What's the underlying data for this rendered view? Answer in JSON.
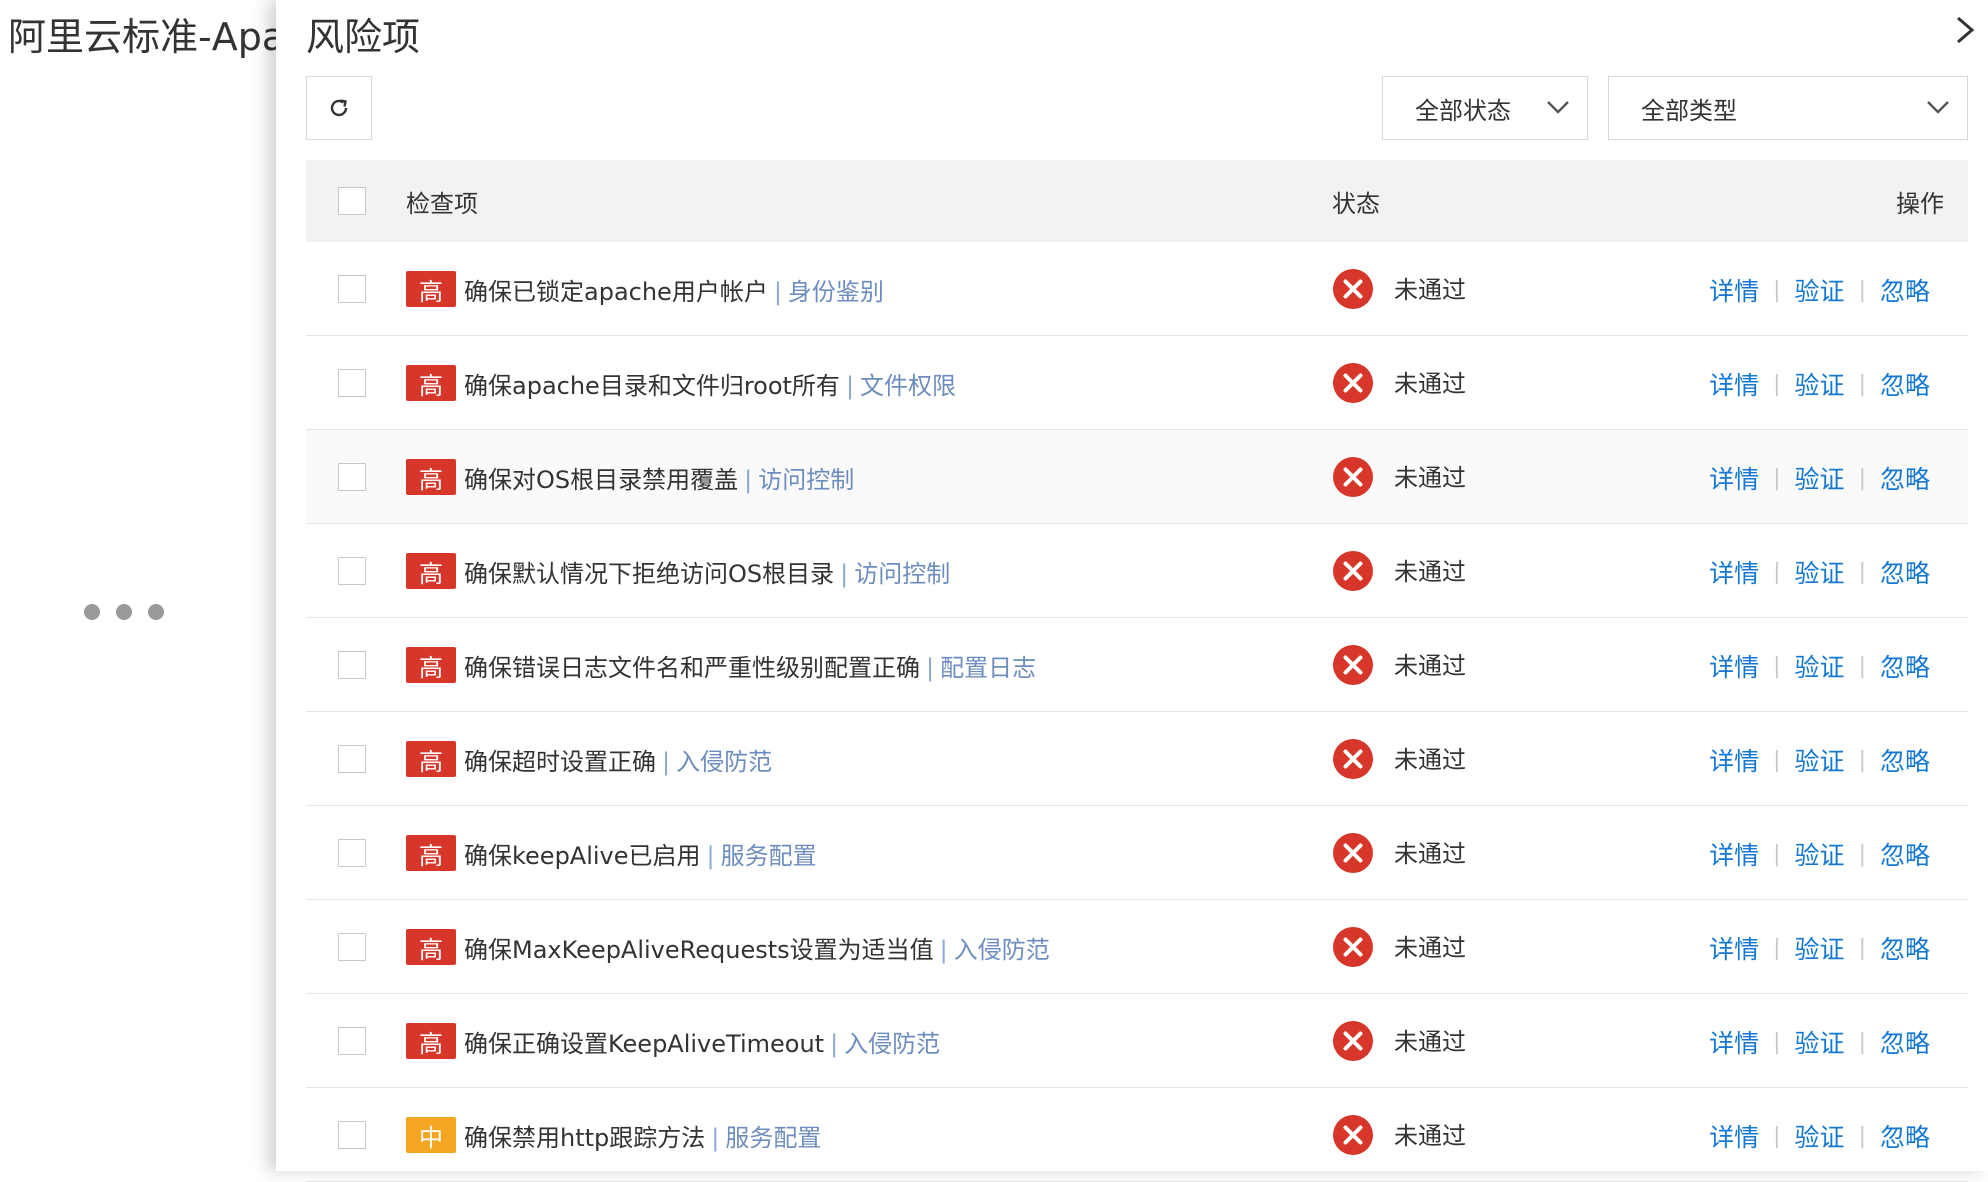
{
  "background": {
    "title": "阿里云标准-Apac"
  },
  "drawer": {
    "title": "风险项",
    "filters": {
      "status": "全部状态",
      "type": "全部类型"
    }
  },
  "table": {
    "headers": {
      "item": "检查项",
      "status": "状态",
      "ops": "操作"
    },
    "rows": [
      {
        "level": "高",
        "level_type": "high",
        "text": "确保已锁定apache用户帐户",
        "category": "身份鉴别",
        "status": "未通过"
      },
      {
        "level": "高",
        "level_type": "high",
        "text": "确保apache目录和文件归root所有",
        "category": "文件权限",
        "status": "未通过"
      },
      {
        "level": "高",
        "level_type": "high",
        "text": "确保对OS根目录禁用覆盖",
        "category": "访问控制",
        "status": "未通过"
      },
      {
        "level": "高",
        "level_type": "high",
        "text": "确保默认情况下拒绝访问OS根目录",
        "category": "访问控制",
        "status": "未通过"
      },
      {
        "level": "高",
        "level_type": "high",
        "text": "确保错误日志文件名和严重性级别配置正确",
        "category": "配置日志",
        "status": "未通过"
      },
      {
        "level": "高",
        "level_type": "high",
        "text": "确保超时设置正确",
        "category": "入侵防范",
        "status": "未通过"
      },
      {
        "level": "高",
        "level_type": "high",
        "text": "确保keepAlive已启用",
        "category": "服务配置",
        "status": "未通过"
      },
      {
        "level": "高",
        "level_type": "high",
        "text": "确保MaxKeepAliveRequests设置为适当值",
        "category": "入侵防范",
        "status": "未通过"
      },
      {
        "level": "高",
        "level_type": "high",
        "text": "确保正确设置KeepAliveTimeout",
        "category": "入侵防范",
        "status": "未通过"
      },
      {
        "level": "中",
        "level_type": "mid",
        "text": "确保禁用http跟踪方法",
        "category": "服务配置",
        "status": "未通过"
      }
    ],
    "ops_labels": {
      "detail": "详情",
      "verify": "验证",
      "ignore": "忽略"
    },
    "separator": "|"
  },
  "colors": {
    "high": "#d7372b",
    "mid": "#f5a623",
    "link": "#1478d2",
    "fail": "#d7372b"
  }
}
